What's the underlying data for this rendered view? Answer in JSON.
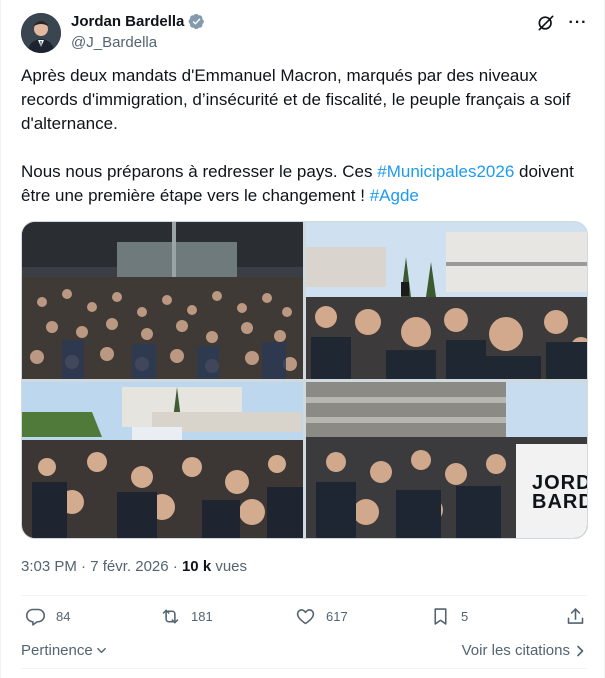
{
  "author": {
    "display_name": "Jordan Bardella",
    "handle": "@J_Bardella",
    "verified_icon": "verified-badge-icon"
  },
  "header_icons": [
    "grok-icon",
    "more-icon"
  ],
  "more_label": "···",
  "tweet": {
    "paragraph1": "Après deux mandats d'Emmanuel Macron, marqués par des niveaux records d'immigration, d’insécurité et de fiscalité, le peuple français a soif d'alternance.",
    "paragraph2_part1": "Nous nous préparons à redresser le pays. Ces ",
    "hashtag1": "#Municipales2026",
    "paragraph2_part2": " doivent être une première étape vers le changement ! ",
    "hashtag2": "#Agde"
  },
  "media": {
    "photo_count": 4,
    "placard_line1": "JORDAN",
    "placard_line2": "BARDE"
  },
  "meta": {
    "time": "3:03 PM",
    "separator": " · ",
    "date": "7 févr. 2026",
    "separator2": " · ",
    "views_count": "10 k",
    "views_label": " vues"
  },
  "actions": {
    "replies": "84",
    "reposts": "181",
    "likes": "617",
    "bookmarks": "5"
  },
  "footer": {
    "relevance_label": "Pertinence",
    "quotes_label": "Voir les citations"
  },
  "colors": {
    "accent": "#1d9bf0",
    "text_primary": "#0f1419",
    "text_secondary": "#536471",
    "divider": "#eff3f4"
  }
}
